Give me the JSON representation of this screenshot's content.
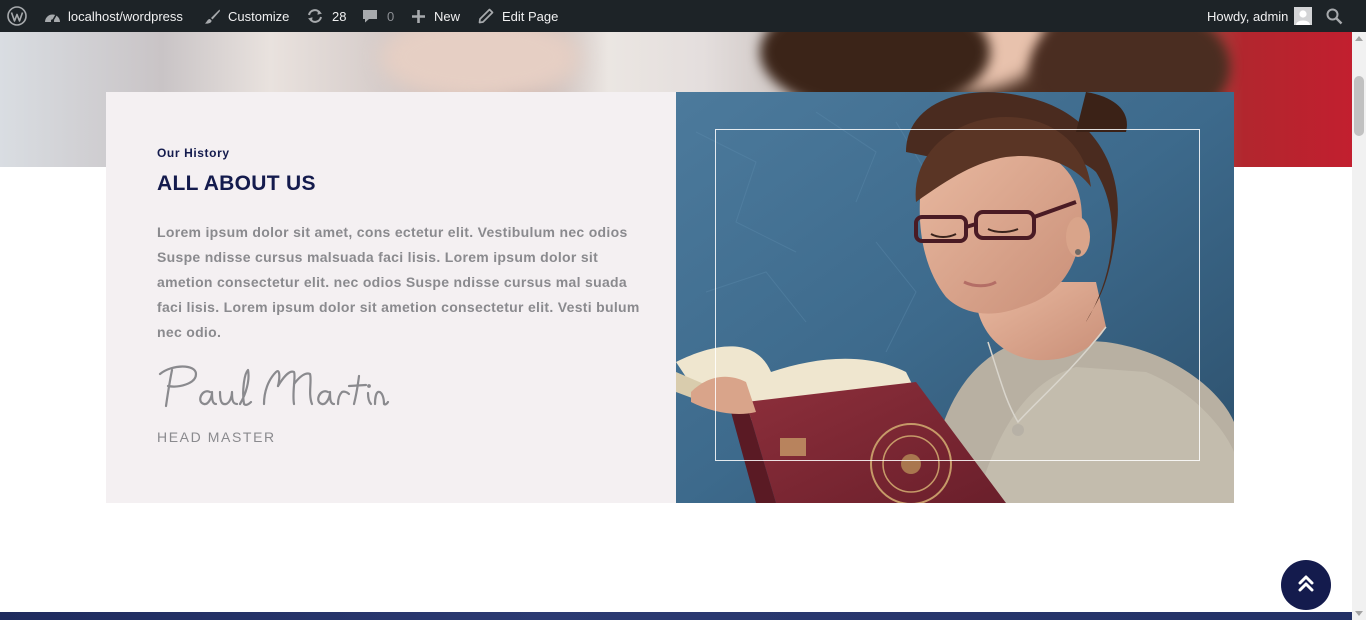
{
  "admin_bar": {
    "site_name": "localhost/wordpress",
    "customize_label": "Customize",
    "updates_count": "28",
    "comments_count": "0",
    "new_label": "New",
    "edit_page_label": "Edit Page",
    "greeting": "Howdy, admin",
    "icons": [
      "wordpress-logo-icon",
      "dashboard-icon",
      "brush-icon",
      "updates-icon",
      "comment-icon",
      "plus-icon",
      "pencil-icon",
      "avatar",
      "search-icon"
    ]
  },
  "about": {
    "subtitle": "Our History",
    "title": "ALL ABOUT US",
    "body": "Lorem ipsum dolor sit amet, cons ectetur elit. Vestibulum nec odios Suspe ndisse cursus malsuada faci lisis. Lorem ipsum dolor sit ametion consectetur elit. nec odios Suspe ndisse cursus mal suada faci lisis. Lorem ipsum dolor sit ametion consectetur elit. Vesti bulum nec odio.",
    "signature": "Paul Martin",
    "role": "HEAD MASTER"
  },
  "controls": {
    "scroll_top_icon": "double-chevron-up-icon"
  },
  "colors": {
    "admin_bar_bg": "#1d2327",
    "navy_accent": "#141b4d",
    "card_bg": "#f4f0f2",
    "body_text": "#8a8a8e"
  }
}
